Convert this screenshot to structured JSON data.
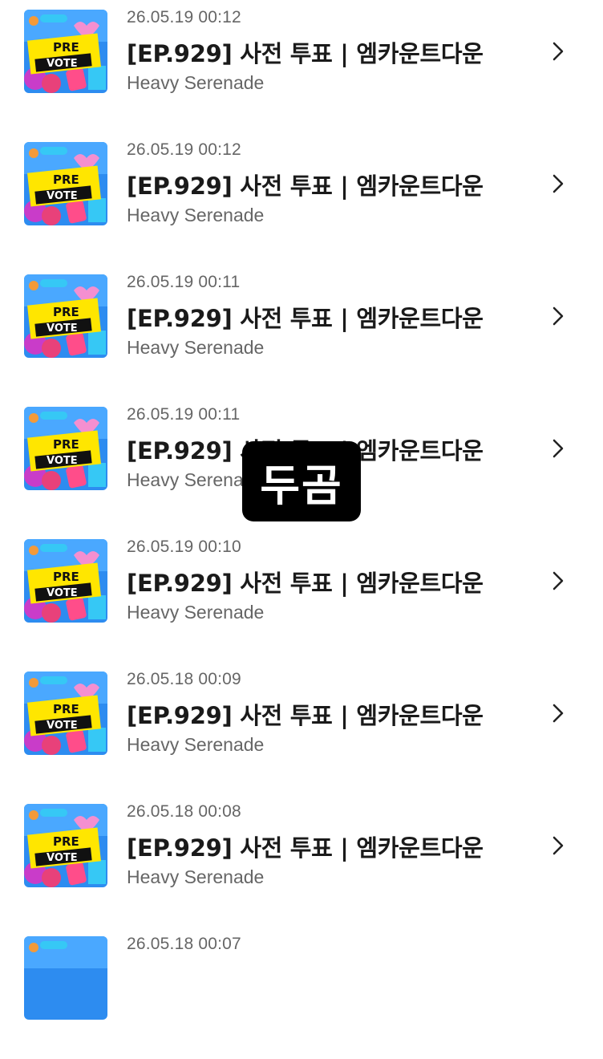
{
  "colors": {
    "title": "#1a1a1a",
    "meta": "#666666",
    "thumb_bg": "#2d8cf0",
    "thumb_banner": "#ffe600"
  },
  "thumbnail": {
    "line1": "PRE",
    "line2": "VOTE"
  },
  "items": [
    {
      "timestamp": "26.05.19 00:12",
      "title": "[EP.929] 사전 투표 | 엠카운트다운",
      "artist": "Heavy Serenade"
    },
    {
      "timestamp": "26.05.19 00:12",
      "title": "[EP.929] 사전 투표 | 엠카운트다운",
      "artist": "Heavy Serenade"
    },
    {
      "timestamp": "26.05.19 00:11",
      "title": "[EP.929] 사전 투표 | 엠카운트다운",
      "artist": "Heavy Serenade"
    },
    {
      "timestamp": "26.05.19 00:11",
      "title": "[EP.929] 사전 투표 | 엠카운트다운",
      "artist": "Heavy Serenade"
    },
    {
      "timestamp": "26.05.19 00:10",
      "title": "[EP.929] 사전 투표 | 엠카운트다운",
      "artist": "Heavy Serenade"
    },
    {
      "timestamp": "26.05.18 00:09",
      "title": "[EP.929] 사전 투표 | 엠카운트다운",
      "artist": "Heavy Serenade"
    },
    {
      "timestamp": "26.05.18 00:08",
      "title": "[EP.929] 사전 투표 | 엠카운트다운",
      "artist": "Heavy Serenade"
    },
    {
      "timestamp": "26.05.18 00:07",
      "title": "",
      "artist": ""
    }
  ],
  "watermark": {
    "text": "두곰"
  }
}
